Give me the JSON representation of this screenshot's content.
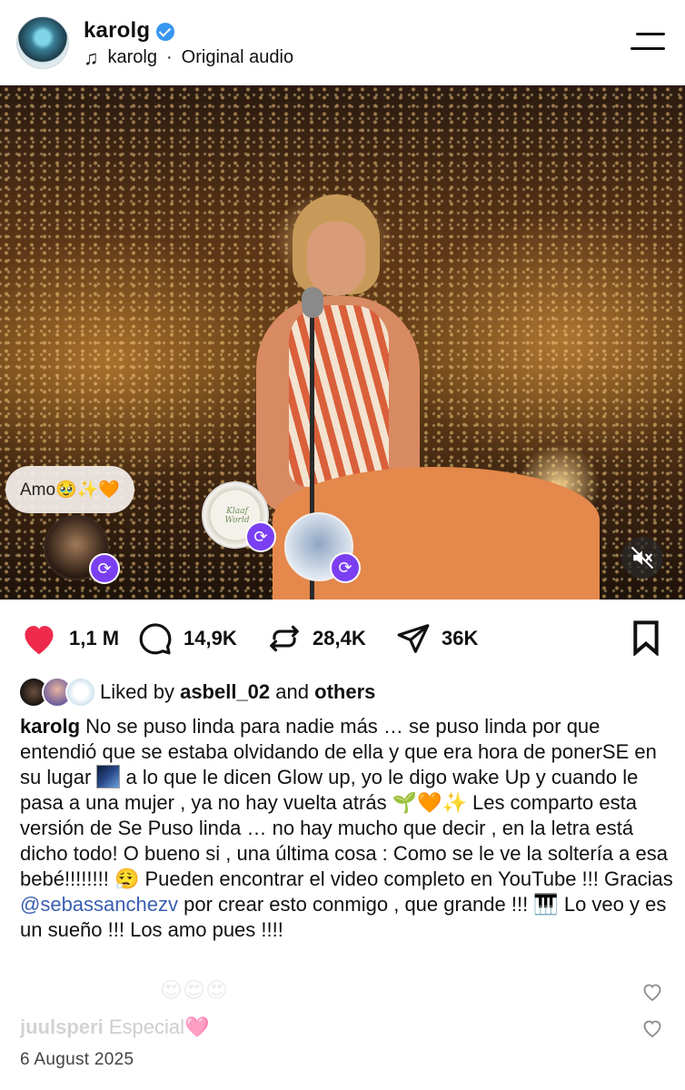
{
  "header": {
    "username": "karolg",
    "audio_user": "karolg",
    "audio_separator": "·",
    "audio_label": "Original audio",
    "icons": [
      "verified-badge-icon",
      "music-note-icon",
      "menu-icon"
    ]
  },
  "video": {
    "comment_bubble": "Amo🥹✨🧡",
    "muted": true,
    "remix_badge_glyph": "⟳",
    "stamp_text": "Klaaf World"
  },
  "actions": {
    "likes": "1,1 M",
    "comments": "14,9K",
    "reposts": "28,4K",
    "shares": "36K",
    "colors": {
      "like_active": "#ed2a4b"
    }
  },
  "liked_by": {
    "prefix": "Liked by",
    "user": "asbell_02",
    "connector": "and",
    "others": "others"
  },
  "caption": {
    "user": "karolg",
    "part1": "No se puso linda para nadie más … se puso linda por que entendió que se estaba olvidando de ella y que era hora de ponerSE en su lugar",
    "part2": "a lo que le dicen Glow up, yo le digo wake Up y cuando le pasa a una mujer , ya no hay vuelta atrás 🌱🧡✨ Les comparto esta versión de Se Puso linda … no hay mucho que decir , en la letra está dicho todo! O bueno si , una última cosa : Como se le ve la soltería a esa bebé!!!!!!!! 😮‍💨 Pueden encontrar el video completo en YouTube !!! Gracias",
    "mention": "@sebassanchezv",
    "part3": "por crear esto conmigo , que grande !!! 🎹 Lo veo y es un sueño !!! Los amo pues !!!!"
  },
  "comments_preview": {
    "emoji_row": "😍😍😍",
    "row_user": "juulsperi",
    "row_text": "Especial🩷"
  },
  "date": "6 August 2025"
}
